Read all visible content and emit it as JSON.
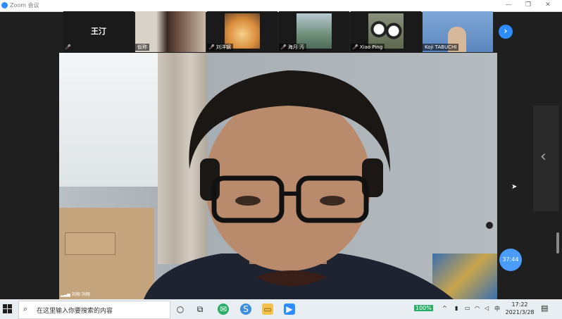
{
  "window": {
    "title": "Zoom 会议",
    "minimize": "—",
    "maximize": "❐",
    "close": "✕"
  },
  "participants": [
    {
      "name": "王汀",
      "muted": true,
      "display": "name-tile"
    },
    {
      "name": "仮称",
      "muted": false,
      "display": "video"
    },
    {
      "name": "刘洋钢",
      "muted": true,
      "display": "video"
    },
    {
      "name": "海月 汚",
      "muted": true,
      "display": "video"
    },
    {
      "name": "Xiao Ping",
      "muted": true,
      "display": "video"
    },
    {
      "name": "Koji TABUCHI",
      "muted": false,
      "display": "video"
    }
  ],
  "strip": {
    "next_arrow": "›"
  },
  "active_speaker": {
    "signal_label": "▂▃▅ 刘翔 刘翔"
  },
  "side_panel": {
    "arrow": "‹"
  },
  "meeting_timer": "37:44",
  "taskbar": {
    "search_placeholder": "在这里输入你要搜索的内容",
    "battery": "100%",
    "ime": "中",
    "time": "17:22",
    "date": "2021/3/28"
  }
}
